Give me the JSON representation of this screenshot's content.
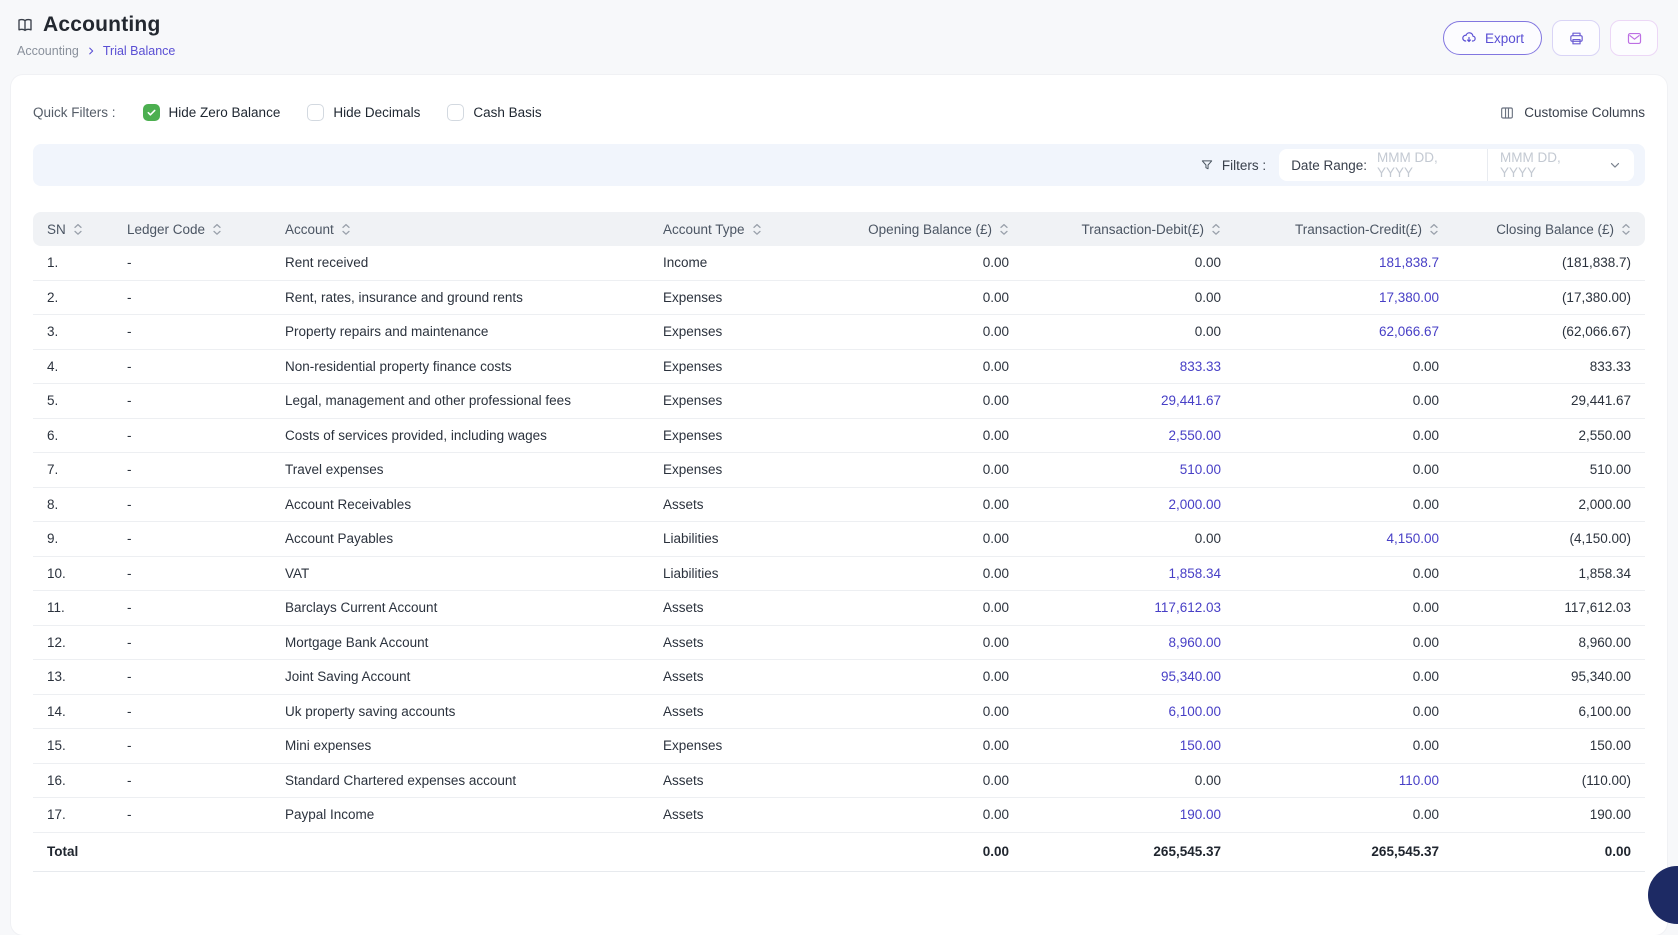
{
  "header": {
    "title": "Accounting",
    "breadcrumb": {
      "parent": "Accounting",
      "current": "Trial Balance"
    },
    "export_label": "Export"
  },
  "quick_filters": {
    "label": "Quick Filters :",
    "items": [
      {
        "label": "Hide Zero Balance",
        "checked": true
      },
      {
        "label": "Hide Decimals",
        "checked": false
      },
      {
        "label": "Cash Basis",
        "checked": false
      }
    ],
    "customise_columns_label": "Customise Columns"
  },
  "filters": {
    "label": "Filters :",
    "date_range_label": "Date Range:",
    "date_from_placeholder": "MMM DD, YYYY",
    "date_to_placeholder": "MMM DD, YYYY"
  },
  "table": {
    "columns": [
      "SN",
      "Ledger Code",
      "Account",
      "Account Type",
      "Opening Balance (£)",
      "Transaction-Debit(£)",
      "Transaction-Credit(£)",
      "Closing Balance (£)"
    ],
    "rows": [
      {
        "sn": "1.",
        "ledger_code": "-",
        "account": "Rent received",
        "account_type": "Income",
        "opening": "0.00",
        "debit": "0.00",
        "credit": "181,838.7",
        "closing": "(181,838.7)"
      },
      {
        "sn": "2.",
        "ledger_code": "-",
        "account": "Rent, rates, insurance and ground rents",
        "account_type": "Expenses",
        "opening": "0.00",
        "debit": "0.00",
        "credit": "17,380.00",
        "closing": "(17,380.00)"
      },
      {
        "sn": "3.",
        "ledger_code": "-",
        "account": "Property repairs and maintenance",
        "account_type": "Expenses",
        "opening": "0.00",
        "debit": "0.00",
        "credit": "62,066.67",
        "closing": "(62,066.67)"
      },
      {
        "sn": "4.",
        "ledger_code": "-",
        "account": "Non-residential property finance costs",
        "account_type": "Expenses",
        "opening": "0.00",
        "debit": "833.33",
        "credit": "0.00",
        "closing": "833.33"
      },
      {
        "sn": "5.",
        "ledger_code": "-",
        "account": "Legal, management and other professional fees",
        "account_type": "Expenses",
        "opening": "0.00",
        "debit": "29,441.67",
        "credit": "0.00",
        "closing": "29,441.67"
      },
      {
        "sn": "6.",
        "ledger_code": "-",
        "account": "Costs of services provided, including wages",
        "account_type": "Expenses",
        "opening": "0.00",
        "debit": "2,550.00",
        "credit": "0.00",
        "closing": "2,550.00"
      },
      {
        "sn": "7.",
        "ledger_code": "-",
        "account": "Travel expenses",
        "account_type": "Expenses",
        "opening": "0.00",
        "debit": "510.00",
        "credit": "0.00",
        "closing": "510.00"
      },
      {
        "sn": "8.",
        "ledger_code": "-",
        "account": "Account Receivables",
        "account_type": "Assets",
        "opening": "0.00",
        "debit": "2,000.00",
        "credit": "0.00",
        "closing": "2,000.00"
      },
      {
        "sn": "9.",
        "ledger_code": "-",
        "account": "Account Payables",
        "account_type": "Liabilities",
        "opening": "0.00",
        "debit": "0.00",
        "credit": "4,150.00",
        "closing": "(4,150.00)"
      },
      {
        "sn": "10.",
        "ledger_code": "-",
        "account": "VAT",
        "account_type": "Liabilities",
        "opening": "0.00",
        "debit": "1,858.34",
        "credit": "0.00",
        "closing": "1,858.34"
      },
      {
        "sn": "11.",
        "ledger_code": "-",
        "account": "Barclays Current Account",
        "account_type": "Assets",
        "opening": "0.00",
        "debit": "117,612.03",
        "credit": "0.00",
        "closing": "117,612.03"
      },
      {
        "sn": "12.",
        "ledger_code": "-",
        "account": "Mortgage Bank Account",
        "account_type": "Assets",
        "opening": "0.00",
        "debit": "8,960.00",
        "credit": "0.00",
        "closing": "8,960.00"
      },
      {
        "sn": "13.",
        "ledger_code": "-",
        "account": "Joint Saving Account",
        "account_type": "Assets",
        "opening": "0.00",
        "debit": "95,340.00",
        "credit": "0.00",
        "closing": "95,340.00"
      },
      {
        "sn": "14.",
        "ledger_code": "-",
        "account": "Uk property saving accounts",
        "account_type": "Assets",
        "opening": "0.00",
        "debit": "6,100.00",
        "credit": "0.00",
        "closing": "6,100.00"
      },
      {
        "sn": "15.",
        "ledger_code": "-",
        "account": "Mini expenses",
        "account_type": "Expenses",
        "opening": "0.00",
        "debit": "150.00",
        "credit": "0.00",
        "closing": "150.00"
      },
      {
        "sn": "16.",
        "ledger_code": "-",
        "account": "Standard Chartered expenses account",
        "account_type": "Assets",
        "opening": "0.00",
        "debit": "0.00",
        "credit": "110.00",
        "closing": "(110.00)"
      },
      {
        "sn": "17.",
        "ledger_code": "-",
        "account": "Paypal Income",
        "account_type": "Assets",
        "opening": "0.00",
        "debit": "190.00",
        "credit": "0.00",
        "closing": "190.00"
      }
    ],
    "total": {
      "label": "Total",
      "opening": "0.00",
      "debit": "265,545.37",
      "credit": "265,545.37",
      "closing": "0.00"
    }
  },
  "colors": {
    "accent_purple": "#5a4fd4",
    "amount_link": "#473fc6",
    "checkbox_green": "#4caf50",
    "filters_bar_bg": "#f1f5fc",
    "table_header_bg": "#f0f2f5",
    "mail_icon": "#bd6fe3",
    "fab_navy": "#1d2a64"
  }
}
